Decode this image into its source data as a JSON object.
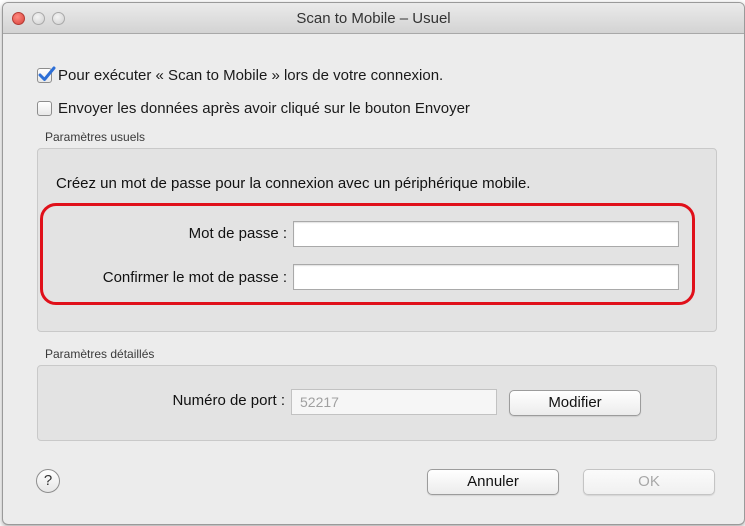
{
  "window": {
    "title": "Scan to Mobile – Usuel"
  },
  "options": {
    "run_at_login": {
      "label": "Pour exécuter « Scan to Mobile » lors de votre connexion.",
      "checked": true
    },
    "send_after_button": {
      "label": "Envoyer les données après avoir cliqué sur le bouton Envoyer",
      "checked": false
    }
  },
  "usual_settings": {
    "group_label": "Paramètres usuels",
    "instruction": "Créez un mot de passe pour la connexion avec un périphérique mobile.",
    "password_label": "Mot de passe :",
    "password_value": "",
    "confirm_label": "Confirmer le mot de passe :",
    "confirm_value": ""
  },
  "detailed_settings": {
    "group_label": "Paramètres détaillés",
    "port_label": "Numéro de port :",
    "port_value": "52217",
    "modify_button": "Modifier"
  },
  "footer": {
    "help_glyph": "?",
    "cancel_button": "Annuler",
    "ok_button": "OK"
  },
  "colors": {
    "highlight": "#e0101a",
    "checkbox_check": "#2d6fd6"
  },
  "icons": {
    "help": "help-icon",
    "check": "checkmark-icon"
  }
}
